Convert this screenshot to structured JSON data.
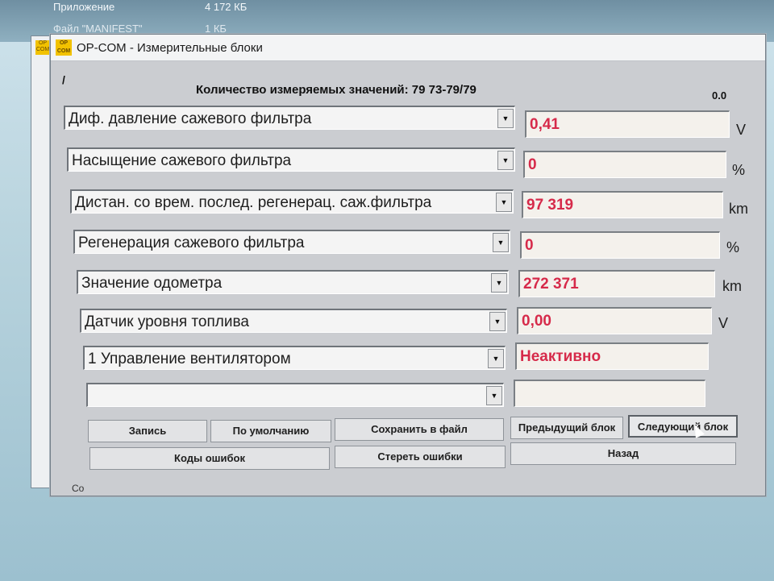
{
  "background_window": {
    "row1": {
      "name": "Приложение",
      "size": "4 172 КБ"
    },
    "row2": {
      "name": "Файл \"MANIFEST\"",
      "size": "1 КБ"
    }
  },
  "back_icon_text": "OP COM",
  "window": {
    "title": "OP-COM - Измерительные блоки",
    "icon_text": "OP COM",
    "marker": "/",
    "count_label": "Количество измеряемых значений: 79  73-79/79",
    "corner_value": "0.0"
  },
  "rows": [
    {
      "label": "Диф. давление сажевого фильтра",
      "value": "0,41",
      "unit": "V"
    },
    {
      "label": "Насыщение сажевого фильтра",
      "value": "0",
      "unit": "%"
    },
    {
      "label": "Дистан. со врем. послед. регенерац. саж.фильтра",
      "value": "97 319",
      "unit": "km"
    },
    {
      "label": "Регенерация сажевого фильтра",
      "value": "0",
      "unit": "%"
    },
    {
      "label": "Значение одометра",
      "value": "272 371",
      "unit": "km"
    },
    {
      "label": "Датчик уровня топлива",
      "value": "0,00",
      "unit": "V"
    },
    {
      "label": "1 Управление вентилятором",
      "value": "Неактивно",
      "unit": ""
    },
    {
      "label": "",
      "value": "",
      "unit": ""
    }
  ],
  "dropdown_arrow": "▼",
  "buttons": {
    "record": "Запись",
    "default": "По умолчанию",
    "save_file": "Сохранить в файл",
    "prev_block": "Предыдущий блок",
    "next_block": "Следующий блок",
    "error_codes": "Коды ошибок",
    "clear_errors": "Стереть ошибки",
    "back": "Назад"
  },
  "status_text": "Co",
  "colors": {
    "value_text": "#d62a4a",
    "icon": "#f2c200"
  }
}
